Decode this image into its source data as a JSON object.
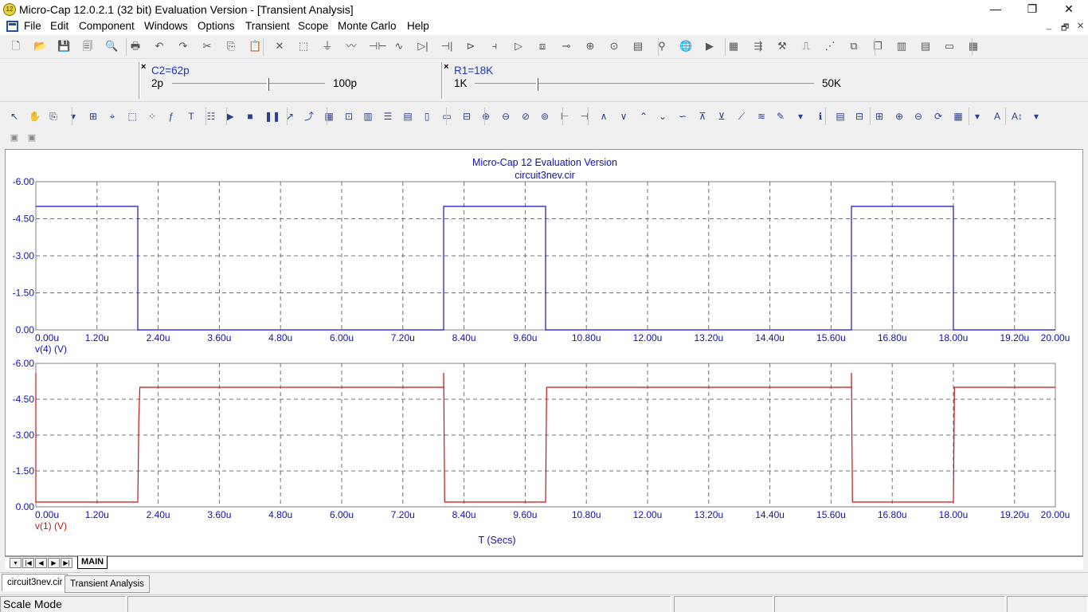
{
  "window": {
    "title": "Micro-Cap 12.0.2.1 (32 bit) Evaluation Version - [Transient Analysis]",
    "app_icon_text": "12",
    "controls": {
      "minimize": "—",
      "restore": "❐",
      "close": "✕"
    },
    "mdi_controls": {
      "minimize": "_",
      "restore": "🗗",
      "close": "✕"
    }
  },
  "menu": [
    "File",
    "Edit",
    "Component",
    "Windows",
    "Options",
    "Transient",
    "Scope",
    "Monte Carlo",
    "Help"
  ],
  "toolbar_main_icons": [
    "new-icon",
    "open-icon",
    "save-icon",
    "save-all-icon",
    "print-preview-icon",
    "print-icon",
    "undo-icon",
    "redo-icon",
    "cut-icon",
    "copy-icon",
    "paste-icon",
    "delete-icon",
    "select-all-icon",
    "ground-icon",
    "resistor-icon",
    "capacitor-icon",
    "inductor-icon",
    "diode-icon",
    "battery-icon",
    "transistor-icon",
    "mosfet-icon",
    "opamp-icon",
    "transformer-icon",
    "switch-icon",
    "node-icon",
    "source-icon",
    "component-panel-icon",
    "probe-icon",
    "globe-icon",
    "run-icon",
    "calc-icon",
    "step-icon",
    "tool-icon",
    "scope-icon",
    "monte-icon",
    "tile-icon",
    "cascade-icon",
    "vertical-icon",
    "horizontal-icon",
    "window-icon",
    "calculator-icon"
  ],
  "sliders": [
    {
      "title": "C2=62p",
      "min": "2p",
      "max": "100p",
      "position": 0.62,
      "close": "×"
    },
    {
      "title": "R1=18K",
      "min": "1K",
      "max": "50K",
      "position": 0.18,
      "close": "×"
    }
  ],
  "toolbar_analysis_icons": [
    "pointer-icon",
    "hand-icon",
    "copy-plot-icon",
    "dropdown-icon",
    "scale-icon",
    "cursor-icon",
    "zoom-box-icon",
    "data-points-icon",
    "formula-icon",
    "text-icon",
    "properties-icon",
    "run-icon",
    "stop-icon",
    "pause-icon",
    "trace-icon",
    "peak-icon",
    "grid-icon",
    "tokens-icon",
    "split-icon",
    "stack-icon",
    "overlay-icon",
    "bounds-icon",
    "tabs-icon",
    "fit-icon",
    "zoom-in-icon",
    "zoom-out-icon",
    "pan-icon",
    "animate-icon",
    "left-cursor-icon",
    "right-cursor-icon",
    "peak-find-icon",
    "valley-find-icon",
    "high-icon",
    "low-icon",
    "inflect-icon",
    "global-high-icon",
    "global-low-icon",
    "slope-icon",
    "ruler-icon",
    "annotate-icon",
    "dropdown-icon",
    "info-icon",
    "library-icon",
    "split-view-icon",
    "tile-view-icon",
    "zoom-in-icon",
    "zoom-out-icon",
    "redraw-icon",
    "palette-icon",
    "dropdown-icon",
    "font-icon",
    "font-size-icon",
    "dropdown-icon"
  ],
  "plot": {
    "header": "Micro-Cap 12 Evaluation Version",
    "filename": "circuit3nev.cir",
    "x_axis_title": "T (Secs)",
    "x_ticks": [
      "0.00u",
      "1.20u",
      "2.40u",
      "3.60u",
      "4.80u",
      "6.00u",
      "7.20u",
      "8.40u",
      "9.60u",
      "10.80u",
      "12.00u",
      "13.20u",
      "14.40u",
      "15.60u",
      "16.80u",
      "18.00u",
      "19.20u",
      "20.00u"
    ],
    "y_ticks": [
      "-6.00",
      "-4.50",
      "-3.00",
      "-1.50",
      "0.00"
    ],
    "colors": {
      "top": "#1010d0",
      "bottom": "#d01010",
      "axis_text": "#1010c0",
      "grid": "#707070"
    }
  },
  "chart_data": [
    {
      "type": "line",
      "ylabel": "v(4) (V)",
      "xlabel": "T (Secs)",
      "xlim": [
        0,
        20
      ],
      "ylim": [
        0,
        -6
      ],
      "x_unit": "u",
      "series": [
        {
          "name": "v(4) (V)",
          "x": [
            0,
            2.0,
            2.0,
            8.0,
            8.0,
            10.0,
            10.0,
            16.0,
            16.0,
            18.0,
            18.0,
            20.0
          ],
          "y": [
            -5.0,
            -5.0,
            0.0,
            0.0,
            -5.0,
            -5.0,
            0.0,
            0.0,
            -5.0,
            -5.0,
            0.0,
            0.0
          ]
        }
      ]
    },
    {
      "type": "line",
      "ylabel": "v(1) (V)",
      "xlabel": "T (Secs)",
      "xlim": [
        0,
        20
      ],
      "ylim": [
        0,
        -6
      ],
      "x_unit": "u",
      "series": [
        {
          "name": "v(1) (V)",
          "x": [
            0,
            0,
            0.02,
            2.0,
            2.02,
            2.04,
            8.0,
            8.0,
            8.02,
            10.0,
            10.02,
            16.0,
            16.0,
            16.02,
            18.0,
            18.02,
            20.0
          ],
          "y": [
            -5.6,
            -0.2,
            -0.2,
            -0.2,
            -3.7,
            -5.0,
            -5.0,
            -5.6,
            -0.2,
            -0.2,
            -5.0,
            -5.0,
            -5.6,
            -0.2,
            -0.2,
            -5.0,
            -5.0
          ]
        }
      ]
    }
  ],
  "tabs": {
    "nav": [
      "▾",
      "|◀",
      "◀",
      "▶",
      "▶|"
    ],
    "sheet": "MAIN",
    "documents": [
      "circuit3nev.cir",
      "Transient Analysis"
    ]
  },
  "status": {
    "mode": "Scale Mode"
  }
}
